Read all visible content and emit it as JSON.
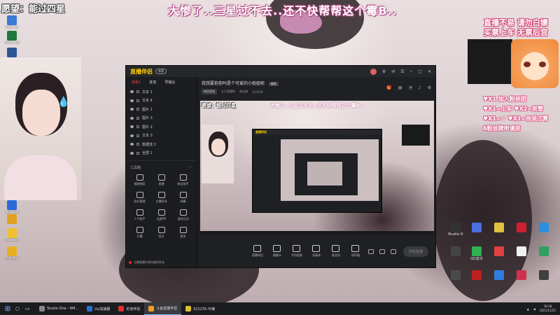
{
  "overlay": {
    "wish": "愿望：能过四星",
    "banner": "大惨了..三星过不去..还不快帮帮这个霉B..",
    "promo": "直播不易 请勿白嫖\n买票上车 无票后宫",
    "rules": [
      "♥X1 加入粉丝团",
      "♥X1=上车  ♥X2=房管",
      "♥X1=♡  ♥X1=你说了算",
      "6粉丝牌申请房"
    ]
  },
  "desktop_icons_left": [
    {
      "label": "Wea fg",
      "color": "#3a7bd5"
    },
    {
      "label": "Excel 2016",
      "color": "#1f7a3f"
    },
    {
      "label": "W",
      "color": "#2b5797"
    }
  ],
  "desktop_icons_left_lower": [
    {
      "label": "BDclaim",
      "color": "#2b6bd8"
    },
    {
      "label": "",
      "color": "#e0a020"
    },
    {
      "label": "Baobao",
      "color": "#f0c030"
    },
    {
      "label": "原产地证",
      "color": "#e8b020"
    }
  ],
  "desktop_icons_right": [
    {
      "label": "Studio One",
      "color": "#333"
    },
    {
      "label": "",
      "color": "#4a6fe0"
    },
    {
      "label": "",
      "color": "#e0c040"
    },
    {
      "label": "",
      "color": "#d02030"
    },
    {
      "label": "",
      "color": "#2a8fe0"
    },
    {
      "label": "",
      "color": "#444"
    },
    {
      "label": "QQ音乐",
      "color": "#30b050"
    },
    {
      "label": "",
      "color": "#e04040"
    },
    {
      "label": "",
      "color": "#f0f0f0"
    },
    {
      "label": "",
      "color": "#30a060"
    },
    {
      "label": "",
      "color": "#4a4a4a"
    },
    {
      "label": "",
      "color": "#c02020"
    },
    {
      "label": "",
      "color": "#2f7de0"
    },
    {
      "label": "",
      "color": "#d03050"
    },
    {
      "label": "",
      "color": "#404040"
    }
  ],
  "app": {
    "name": "直播伴侣",
    "version": "新版",
    "scene_tabs": [
      "场景1",
      "其他",
      "导播台"
    ],
    "sources": [
      "文本 1",
      "文本 4",
      "图片 1",
      "图片 3",
      "图片 2",
      "文本 3",
      "数据流 2",
      "全屏 1"
    ],
    "tools_title": "工具箱",
    "tools": [
      "福袋抽奖",
      "直播",
      "粉丝助手",
      "观众管理",
      "主播秀场",
      "绿幕",
      "人气助手",
      "连麦PK",
      "游戏互动",
      "开播",
      "音乐",
      "更多"
    ],
    "notice": "主播直播中请勿使用外挂",
    "room": {
      "title": "我想要抱抱吗是个可爱的小姐姐呢",
      "edit": "编辑",
      "category": "单机游戏",
      "stat1": "五万直播ID",
      "stat2": "粉丝数",
      "stat3": "127418"
    },
    "bottom_tools": [
      "直播伴侣",
      "摄像头",
      "手机投屏",
      "多媒体",
      "麦克风",
      "扬声器"
    ],
    "go_live": "开始直播"
  },
  "taskbar": {
    "items": [
      {
        "label": "Studio One - RM...",
        "color": "#888"
      },
      {
        "label": "Uu加速器",
        "color": "#2a6fd8"
      },
      {
        "label": "无他伴侣",
        "color": "#e03030"
      },
      {
        "label": "斗鱼直播伴侣",
        "color": "#f0a020",
        "active": true
      },
      {
        "label": "522235-可编",
        "color": "#e0c030"
      }
    ],
    "time": "18:18",
    "date": "2021/11/25"
  }
}
